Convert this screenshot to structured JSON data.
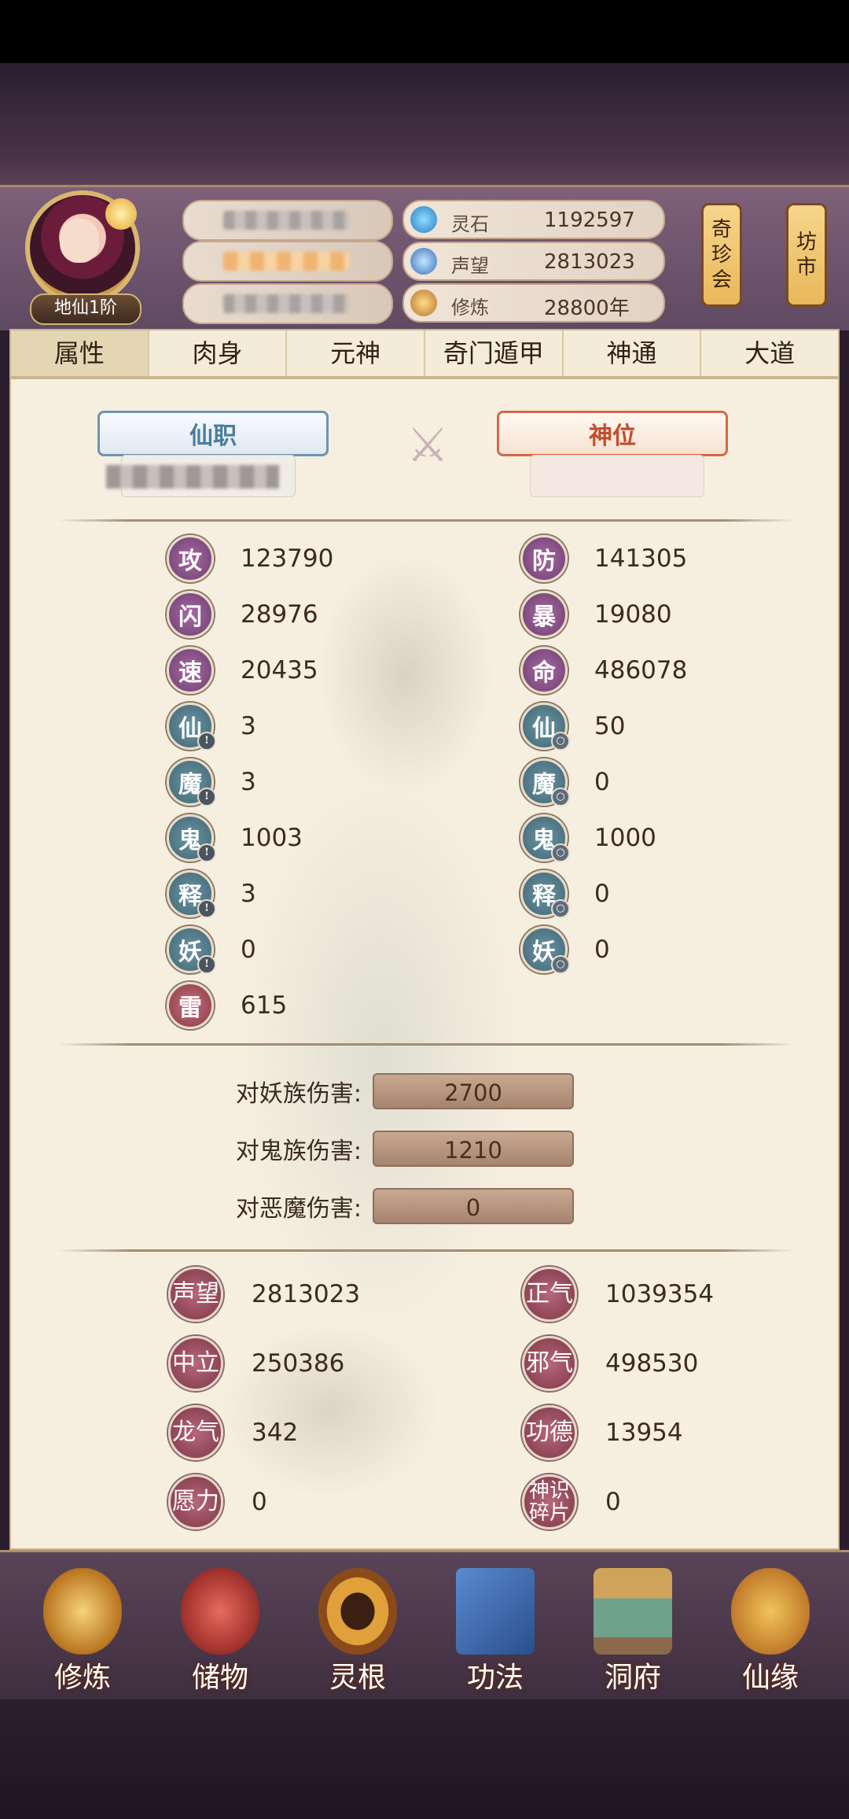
{
  "player": {
    "rank": "地仙1阶"
  },
  "resources": [
    {
      "icon": "spirit-stone-icon",
      "label": "灵石",
      "value": "1192597"
    },
    {
      "icon": "reputation-crystal-icon",
      "label": "声望",
      "value": "2813023"
    },
    {
      "icon": "meditation-icon",
      "label": "修炼",
      "value": "28800年"
    }
  ],
  "lanterns": {
    "treasure": [
      "奇",
      "珍",
      "会"
    ],
    "market": [
      "坊",
      "市"
    ]
  },
  "tabs": [
    "属性",
    "肉身",
    "元神",
    "奇门遁甲",
    "神通",
    "大道"
  ],
  "banners": {
    "left": "仙职",
    "right": "神位"
  },
  "stats_left": [
    {
      "glyph": "攻",
      "value": "123790"
    },
    {
      "glyph": "闪",
      "value": "28976"
    },
    {
      "glyph": "速",
      "value": "20435"
    },
    {
      "glyph": "仙",
      "value": "3"
    },
    {
      "glyph": "魔",
      "value": "3"
    },
    {
      "glyph": "鬼",
      "value": "1003"
    },
    {
      "glyph": "释",
      "value": "3"
    },
    {
      "glyph": "妖",
      "value": "0"
    },
    {
      "glyph": "雷",
      "value": "615"
    }
  ],
  "stats_right": [
    {
      "glyph": "防",
      "value": "141305"
    },
    {
      "glyph": "暴",
      "value": "19080"
    },
    {
      "glyph": "命",
      "value": "486078"
    },
    {
      "glyph": "仙",
      "value": "50"
    },
    {
      "glyph": "魔",
      "value": "0"
    },
    {
      "glyph": "鬼",
      "value": "1000"
    },
    {
      "glyph": "释",
      "value": "0"
    },
    {
      "glyph": "妖",
      "value": "0"
    }
  ],
  "damage": [
    {
      "label": "对妖族伤害:",
      "value": "2700"
    },
    {
      "label": "对鬼族伤害:",
      "value": "1210"
    },
    {
      "label": "对恶魔伤害:",
      "value": "0"
    }
  ],
  "fame_left": [
    {
      "glyph": "声望",
      "value": "2813023"
    },
    {
      "glyph": "中立",
      "value": "250386"
    },
    {
      "glyph": "龙气",
      "value": "342"
    },
    {
      "glyph": "愿力",
      "value": "0"
    }
  ],
  "fame_right": [
    {
      "glyph": "正气",
      "value": "1039354"
    },
    {
      "glyph": "邪气",
      "value": "498530"
    },
    {
      "glyph": "功德",
      "value": "13954"
    },
    {
      "glyph": "神识碎片",
      "value": "0"
    }
  ],
  "nav": [
    "修炼",
    "储物",
    "灵根",
    "功法",
    "洞府",
    "仙缘"
  ],
  "colors": {
    "accent": "#7e6079",
    "panel": "#f6efe0",
    "badge_purple": "#6e3f70",
    "badge_teal": "#3f6674",
    "badge_red": "#8c3a47"
  }
}
